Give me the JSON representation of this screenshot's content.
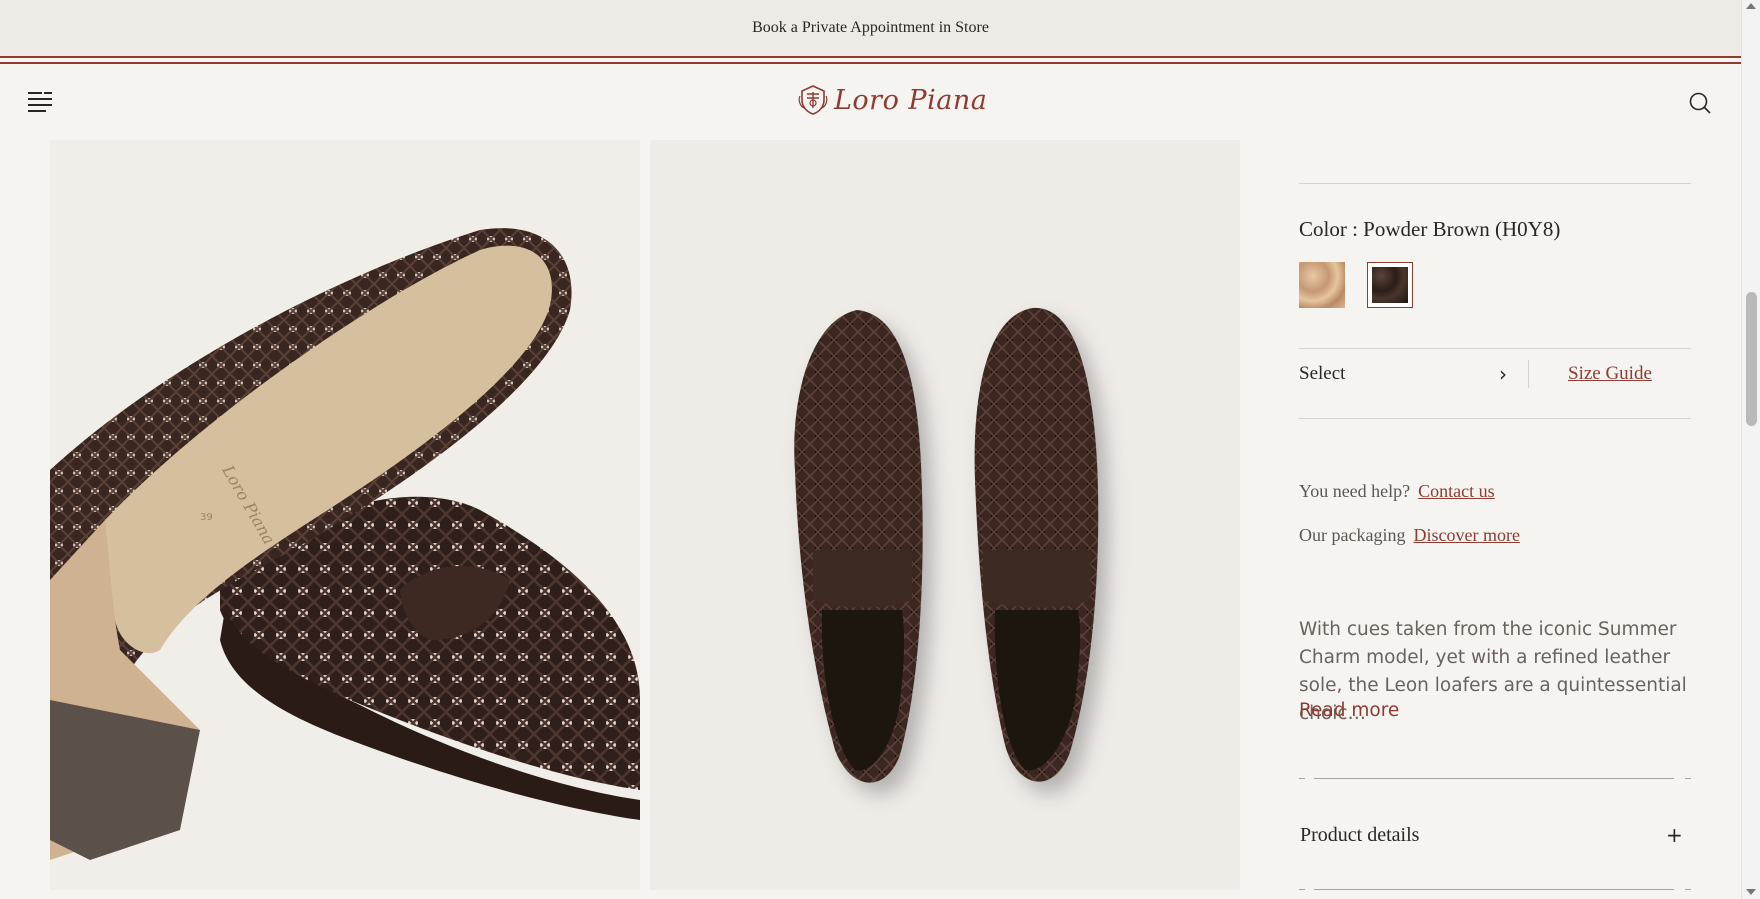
{
  "banner": {
    "text": "Book a Private Appointment in Store"
  },
  "header": {
    "brand": "Loro Piana",
    "menu_icon": "hamburger-menu-icon",
    "search_icon": "search-icon"
  },
  "gallery": {
    "images": [
      {
        "subject": "loafer-sole-view"
      },
      {
        "subject": "loafers-top-view"
      }
    ]
  },
  "product": {
    "color_label": "Color : Powder Brown (H0Y8)",
    "swatches": [
      {
        "name": "light-tan",
        "selected": false
      },
      {
        "name": "powder-brown",
        "selected": true
      }
    ],
    "size_select_label": "Select",
    "size_guide_label": "Size Guide",
    "help_text": "You need help?",
    "contact_link": "Contact us",
    "packaging_text": "Our packaging",
    "packaging_link": "Discover more",
    "description": "With cues taken from the iconic Summer Charm model, yet with a refined leather sole, the Leon loafers are a quintessential choic…",
    "read_more": "Read more",
    "details_label": "Product details",
    "details_toggle": "+"
  },
  "colors": {
    "accent": "#8e3b31",
    "background": "#f6f4f0",
    "banner_bg": "#eeebe6"
  }
}
